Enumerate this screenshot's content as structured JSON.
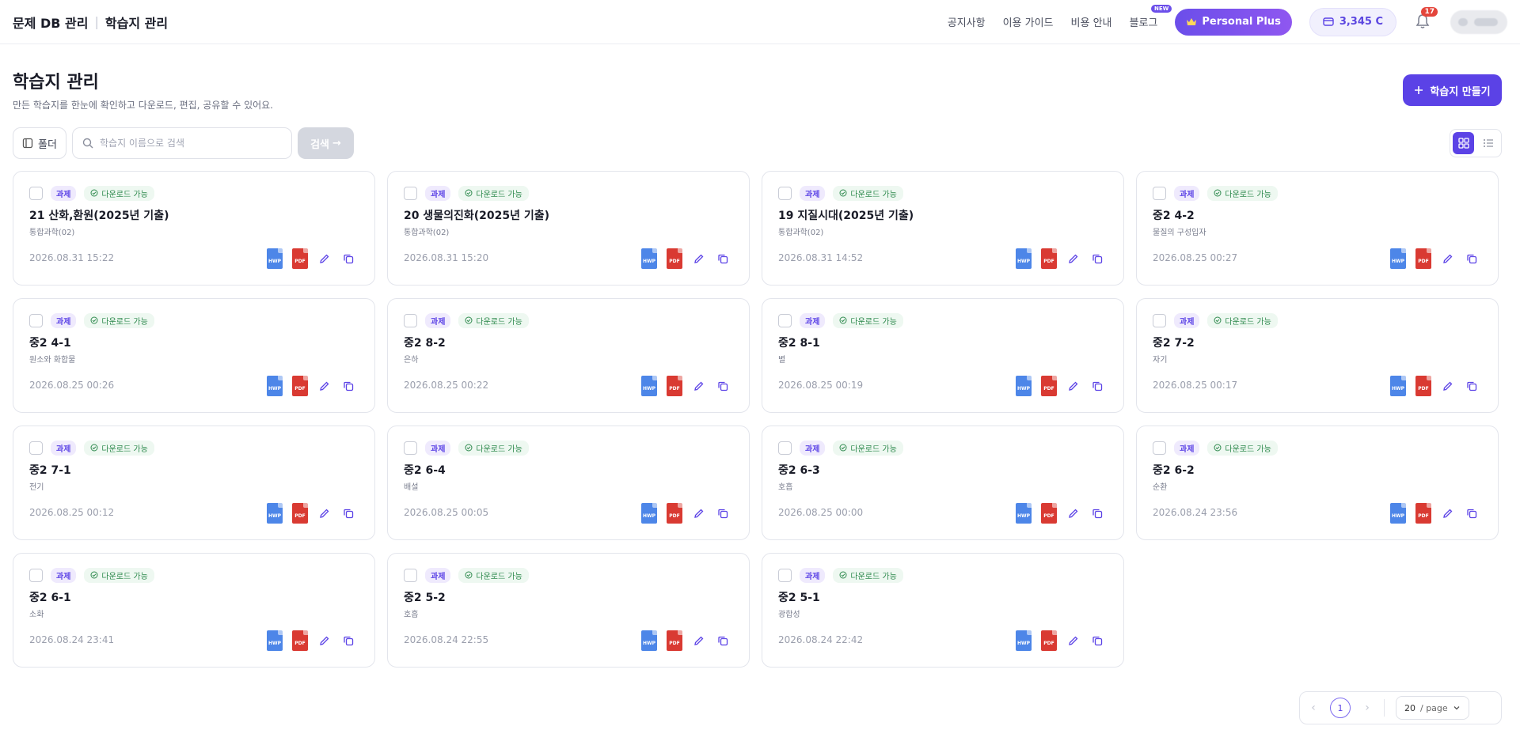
{
  "header": {
    "brand": "문제 DB 관리",
    "section": "학습지 관리",
    "nav": [
      {
        "label": "공지사항"
      },
      {
        "label": "이용 가이드"
      },
      {
        "label": "비용 안내"
      },
      {
        "label": "블로그",
        "badge": "NEW"
      }
    ],
    "plan_label": "Personal Plus",
    "credit_label": "3,345 C",
    "notification_count": "17"
  },
  "page": {
    "title": "학습지 관리",
    "subtitle": "만든 학습지를 한눈에 확인하고 다운로드, 편집, 공유할 수 있어요.",
    "create_label": "학습지 만들기"
  },
  "toolbar": {
    "folder_label": "폴더",
    "search_placeholder": "학습지 이름으로 검색",
    "search_label": "검색",
    "view_mode": "grid"
  },
  "cards": [
    {
      "type": "과제",
      "status": "다운로드 가능",
      "title": "21 산화,환원(2025년 기출)",
      "subtitle": "통합과학(02)",
      "date": "2026.08.31 15:22"
    },
    {
      "type": "과제",
      "status": "다운로드 가능",
      "title": "20 생물의진화(2025년 기출)",
      "subtitle": "통합과학(02)",
      "date": "2026.08.31 15:20"
    },
    {
      "type": "과제",
      "status": "다운로드 가능",
      "title": "19 지질시대(2025년 기출)",
      "subtitle": "통합과학(02)",
      "date": "2026.08.31 14:52"
    },
    {
      "type": "과제",
      "status": "다운로드 가능",
      "title": "중2 4-2",
      "subtitle": "물질의 구성입자",
      "date": "2026.08.25 00:27"
    },
    {
      "type": "과제",
      "status": "다운로드 가능",
      "title": "중2 4-1",
      "subtitle": "원소와 화합물",
      "date": "2026.08.25 00:26"
    },
    {
      "type": "과제",
      "status": "다운로드 가능",
      "title": "중2 8-2",
      "subtitle": "은하",
      "date": "2026.08.25 00:22"
    },
    {
      "type": "과제",
      "status": "다운로드 가능",
      "title": "중2 8-1",
      "subtitle": "별",
      "date": "2026.08.25 00:19"
    },
    {
      "type": "과제",
      "status": "다운로드 가능",
      "title": "중2 7-2",
      "subtitle": "자기",
      "date": "2026.08.25 00:17"
    },
    {
      "type": "과제",
      "status": "다운로드 가능",
      "title": "중2 7-1",
      "subtitle": "전기",
      "date": "2026.08.25 00:12"
    },
    {
      "type": "과제",
      "status": "다운로드 가능",
      "title": "중2 6-4",
      "subtitle": "배설",
      "date": "2026.08.25 00:05"
    },
    {
      "type": "과제",
      "status": "다운로드 가능",
      "title": "중2 6-3",
      "subtitle": "호흡",
      "date": "2026.08.25 00:00"
    },
    {
      "type": "과제",
      "status": "다운로드 가능",
      "title": "중2 6-2",
      "subtitle": "순환",
      "date": "2026.08.24 23:56"
    },
    {
      "type": "과제",
      "status": "다운로드 가능",
      "title": "중2 6-1",
      "subtitle": "소화",
      "date": "2026.08.24 23:41"
    },
    {
      "type": "과제",
      "status": "다운로드 가능",
      "title": "중2 5-2",
      "subtitle": "호흡",
      "date": "2026.08.24 22:55"
    },
    {
      "type": "과제",
      "status": "다운로드 가능",
      "title": "중2 5-1",
      "subtitle": "광합성",
      "date": "2026.08.24 22:42"
    }
  ],
  "file_labels": {
    "hwp": "HWP",
    "pdf": "PDF"
  },
  "pagination": {
    "current_page": "1",
    "page_size": "20",
    "page_size_unit": "/ page"
  },
  "colors": {
    "accent": "#5b42e6",
    "hwp": "#4d86e8",
    "pdf": "#d93a32",
    "status_green": "#2f8a4e"
  }
}
